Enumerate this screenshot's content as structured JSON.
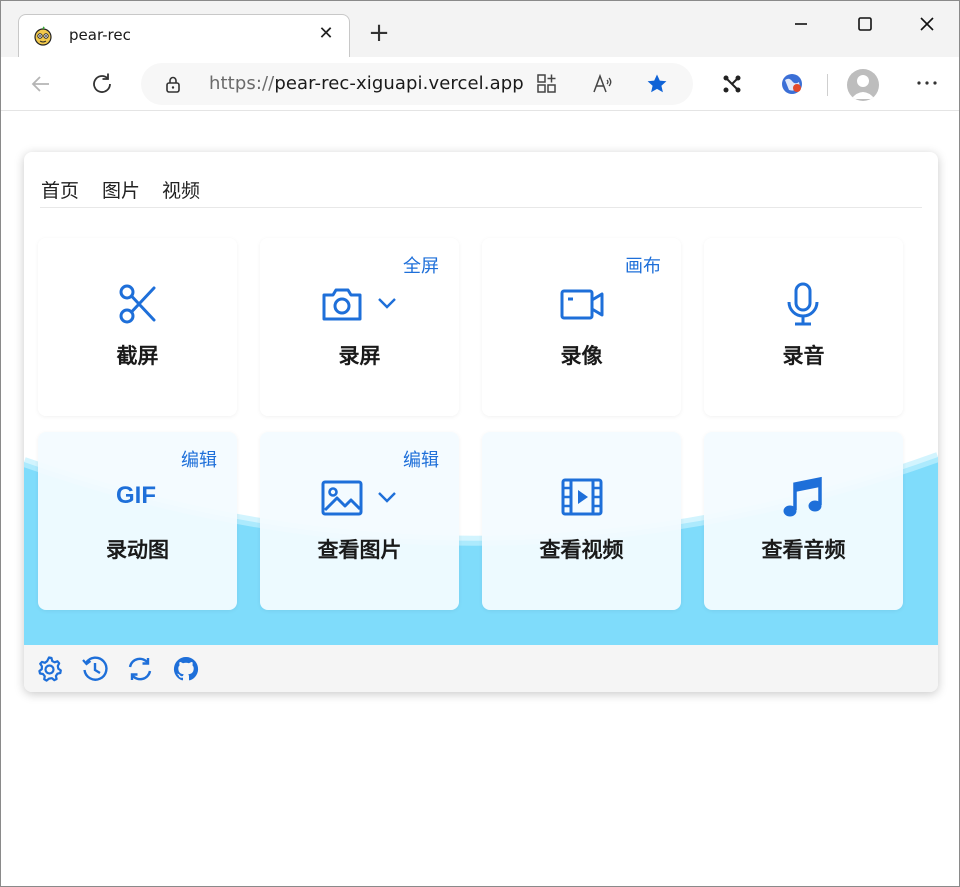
{
  "browser": {
    "tab_title": "pear-rec",
    "tab_close": "✕",
    "new_tab": "+",
    "url_protocol": "https://",
    "url_host": "pear-rec-xiguapi.vercel.app"
  },
  "colors": {
    "accent": "#1e6fd9",
    "wave": "#7fdcfb",
    "footer": "#f5f5f5"
  },
  "menu": {
    "items": [
      {
        "label": "首页"
      },
      {
        "label": "图片"
      },
      {
        "label": "视频"
      }
    ]
  },
  "tiles": [
    {
      "label": "截屏",
      "tag": "",
      "icon": "scissors-icon"
    },
    {
      "label": "录屏",
      "tag": "全屏",
      "icon": "camera-icon"
    },
    {
      "label": "录像",
      "tag": "画布",
      "icon": "video-camera-icon"
    },
    {
      "label": "录音",
      "tag": "",
      "icon": "microphone-icon"
    },
    {
      "label": "录动图",
      "tag": "编辑",
      "icon": "gif-icon",
      "icon_text": "GIF"
    },
    {
      "label": "查看图片",
      "tag": "编辑",
      "icon": "image-icon"
    },
    {
      "label": "查看视频",
      "tag": "",
      "icon": "film-icon"
    },
    {
      "label": "查看音频",
      "tag": "",
      "icon": "music-note-icon"
    }
  ],
  "footer": {
    "icons": [
      "settings-icon",
      "history-icon",
      "refresh-icon",
      "github-icon"
    ]
  }
}
